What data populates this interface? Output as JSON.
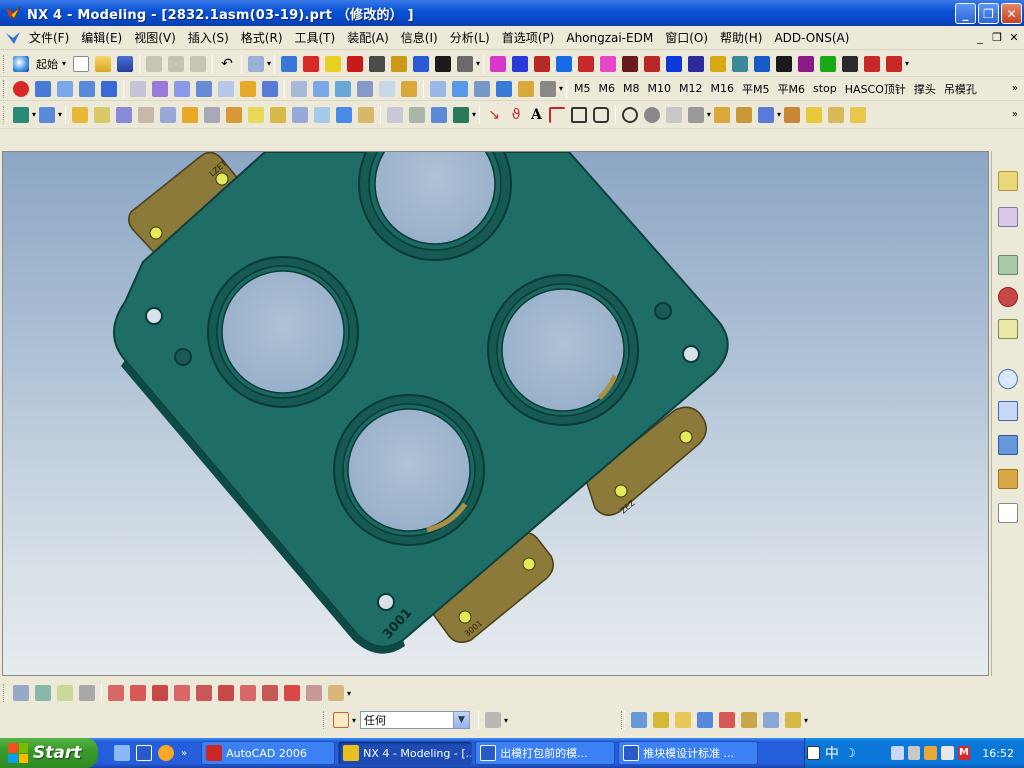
{
  "window": {
    "title": "NX 4 - Modeling - [2832.1asm(03-19).prt （修改的） ]",
    "minimize": "_",
    "maximize": "❒",
    "close": "✕"
  },
  "menu": {
    "items": [
      {
        "label": "文件(F)"
      },
      {
        "label": "编辑(E)"
      },
      {
        "label": "视图(V)"
      },
      {
        "label": "插入(S)"
      },
      {
        "label": "格式(R)"
      },
      {
        "label": "工具(T)"
      },
      {
        "label": "装配(A)"
      },
      {
        "label": "信息(I)"
      },
      {
        "label": "分析(L)"
      },
      {
        "label": "首选项(P)"
      },
      {
        "label": "Ahongzai-EDM"
      },
      {
        "label": "窗口(O)"
      },
      {
        "label": "帮助(H)"
      },
      {
        "label": "ADD-ONS(A)"
      }
    ],
    "mdi_min": "_",
    "mdi_restore": "❒",
    "mdi_close": "✕"
  },
  "toolbar1": {
    "start_label": "起始",
    "more": "»"
  },
  "toolbar2": {
    "text_buttons": [
      "M5",
      "M6",
      "M8",
      "M10",
      "M12",
      "M16",
      "平M5",
      "平M6",
      "stop",
      "HASCO顶针",
      "撑头",
      "吊模孔"
    ],
    "more": "»"
  },
  "toolbar3": {
    "text_tool": "A",
    "more": "»"
  },
  "viewport": {
    "engravings": [
      "3001",
      "LZET",
      "ZEZ",
      "3001",
      "3001"
    ]
  },
  "bottom": {
    "filter_value": "任何"
  },
  "taskbar": {
    "start_label": "Start",
    "buttons": [
      {
        "label": "AutoCAD 2006"
      },
      {
        "label": "NX 4 - Modeling - [..."
      },
      {
        "label": "出模打包前的模..."
      },
      {
        "label": "推块模设计标准 ..."
      }
    ],
    "ime": "中",
    "clock": "16:52"
  },
  "colors": {
    "part": "#1E6E67",
    "part_edge": "#0E3F3B",
    "lug": "#8C7A3A",
    "xp_blue": "#245EDB"
  }
}
